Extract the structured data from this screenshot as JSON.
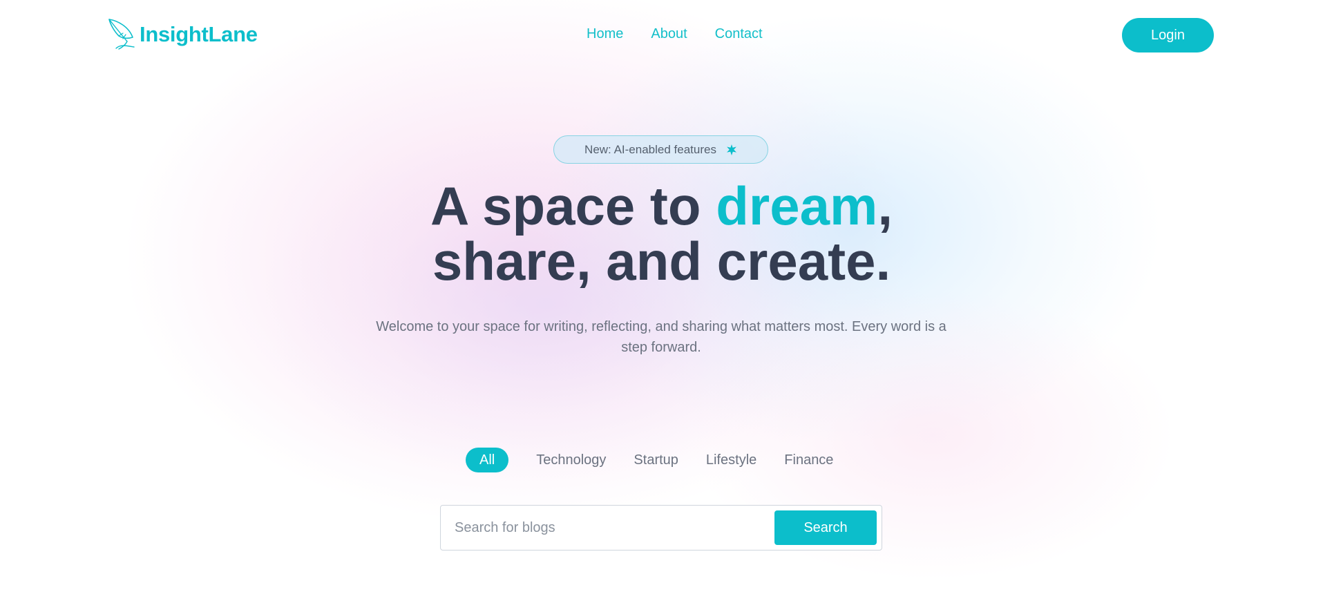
{
  "brand": {
    "name": "InsightLane",
    "icon": "feather-icon",
    "color": "#0cbecb"
  },
  "nav": {
    "items": [
      {
        "label": "Home"
      },
      {
        "label": "About"
      },
      {
        "label": "Contact"
      }
    ],
    "login_label": "Login"
  },
  "hero": {
    "badge_text": "New: AI-enabled features",
    "badge_icon": "sparkle-icon",
    "headline_part1": "A space to ",
    "headline_accent": "dream",
    "headline_part2": ",",
    "headline_line2": "share, and create.",
    "subtitle": "Welcome to your space for writing, reflecting, and sharing what matters most. Every word is a step forward."
  },
  "categories": {
    "items": [
      {
        "label": "All",
        "active": true
      },
      {
        "label": "Technology",
        "active": false
      },
      {
        "label": "Startup",
        "active": false
      },
      {
        "label": "Lifestyle",
        "active": false
      },
      {
        "label": "Finance",
        "active": false
      }
    ]
  },
  "search": {
    "placeholder": "Search for blogs",
    "value": "",
    "button_label": "Search"
  },
  "colors": {
    "accent": "#0cbecb",
    "heading": "#343d52",
    "muted": "#6b7280"
  }
}
